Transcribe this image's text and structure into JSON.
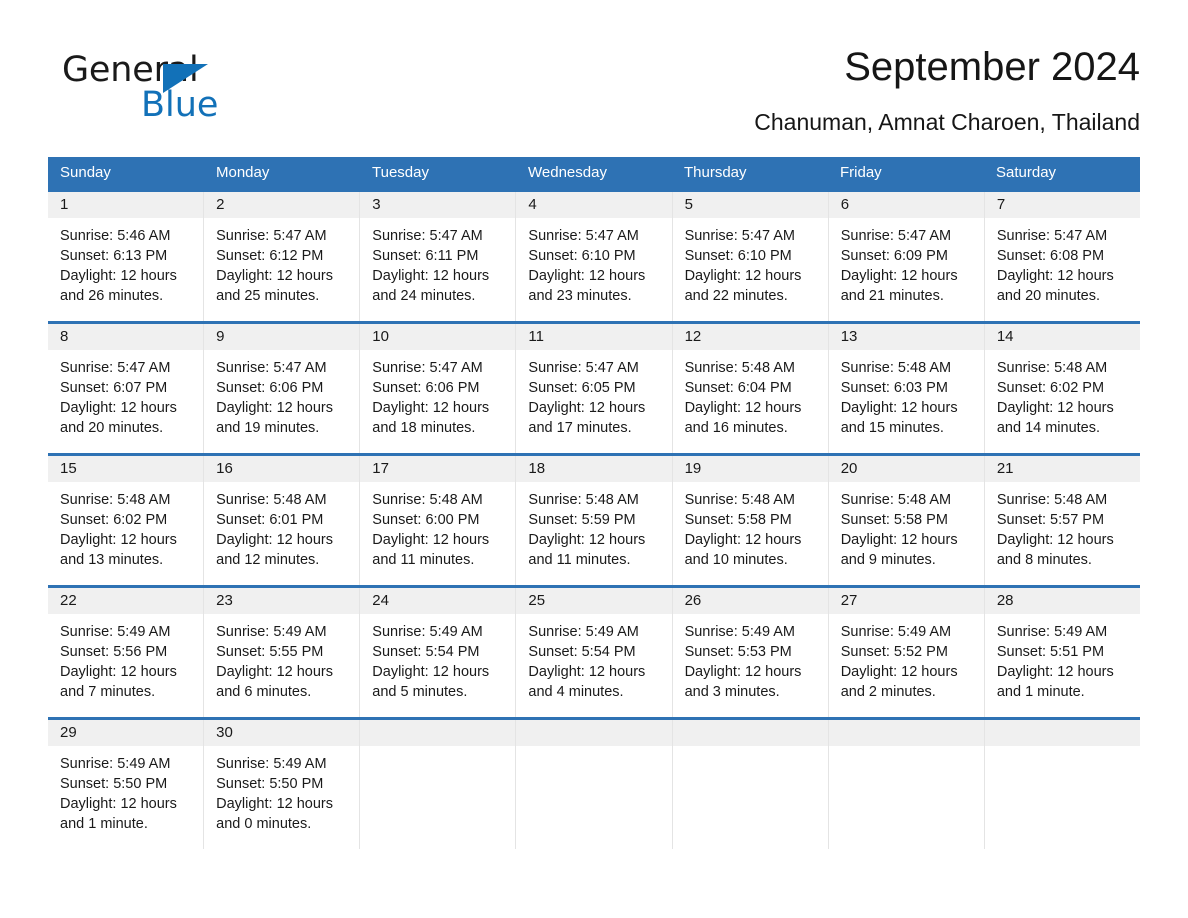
{
  "brand": {
    "name_part1": "General",
    "name_part2": "Blue",
    "logo_icon": "triangle-logo-icon",
    "accent_color": "#1271b8"
  },
  "header": {
    "title": "September 2024",
    "location": "Chanuman, Amnat Charoen, Thailand"
  },
  "theme": {
    "header_blue": "#2e72b4",
    "day_band_gray": "#f0f0f0",
    "cell_border": "#e4e4e4"
  },
  "weekdays": [
    "Sunday",
    "Monday",
    "Tuesday",
    "Wednesday",
    "Thursday",
    "Friday",
    "Saturday"
  ],
  "weeks": [
    [
      {
        "day": "1",
        "sunrise": "Sunrise: 5:46 AM",
        "sunset": "Sunset: 6:13 PM",
        "daylight1": "Daylight: 12 hours",
        "daylight2": "and 26 minutes."
      },
      {
        "day": "2",
        "sunrise": "Sunrise: 5:47 AM",
        "sunset": "Sunset: 6:12 PM",
        "daylight1": "Daylight: 12 hours",
        "daylight2": "and 25 minutes."
      },
      {
        "day": "3",
        "sunrise": "Sunrise: 5:47 AM",
        "sunset": "Sunset: 6:11 PM",
        "daylight1": "Daylight: 12 hours",
        "daylight2": "and 24 minutes."
      },
      {
        "day": "4",
        "sunrise": "Sunrise: 5:47 AM",
        "sunset": "Sunset: 6:10 PM",
        "daylight1": "Daylight: 12 hours",
        "daylight2": "and 23 minutes."
      },
      {
        "day": "5",
        "sunrise": "Sunrise: 5:47 AM",
        "sunset": "Sunset: 6:10 PM",
        "daylight1": "Daylight: 12 hours",
        "daylight2": "and 22 minutes."
      },
      {
        "day": "6",
        "sunrise": "Sunrise: 5:47 AM",
        "sunset": "Sunset: 6:09 PM",
        "daylight1": "Daylight: 12 hours",
        "daylight2": "and 21 minutes."
      },
      {
        "day": "7",
        "sunrise": "Sunrise: 5:47 AM",
        "sunset": "Sunset: 6:08 PM",
        "daylight1": "Daylight: 12 hours",
        "daylight2": "and 20 minutes."
      }
    ],
    [
      {
        "day": "8",
        "sunrise": "Sunrise: 5:47 AM",
        "sunset": "Sunset: 6:07 PM",
        "daylight1": "Daylight: 12 hours",
        "daylight2": "and 20 minutes."
      },
      {
        "day": "9",
        "sunrise": "Sunrise: 5:47 AM",
        "sunset": "Sunset: 6:06 PM",
        "daylight1": "Daylight: 12 hours",
        "daylight2": "and 19 minutes."
      },
      {
        "day": "10",
        "sunrise": "Sunrise: 5:47 AM",
        "sunset": "Sunset: 6:06 PM",
        "daylight1": "Daylight: 12 hours",
        "daylight2": "and 18 minutes."
      },
      {
        "day": "11",
        "sunrise": "Sunrise: 5:47 AM",
        "sunset": "Sunset: 6:05 PM",
        "daylight1": "Daylight: 12 hours",
        "daylight2": "and 17 minutes."
      },
      {
        "day": "12",
        "sunrise": "Sunrise: 5:48 AM",
        "sunset": "Sunset: 6:04 PM",
        "daylight1": "Daylight: 12 hours",
        "daylight2": "and 16 minutes."
      },
      {
        "day": "13",
        "sunrise": "Sunrise: 5:48 AM",
        "sunset": "Sunset: 6:03 PM",
        "daylight1": "Daylight: 12 hours",
        "daylight2": "and 15 minutes."
      },
      {
        "day": "14",
        "sunrise": "Sunrise: 5:48 AM",
        "sunset": "Sunset: 6:02 PM",
        "daylight1": "Daylight: 12 hours",
        "daylight2": "and 14 minutes."
      }
    ],
    [
      {
        "day": "15",
        "sunrise": "Sunrise: 5:48 AM",
        "sunset": "Sunset: 6:02 PM",
        "daylight1": "Daylight: 12 hours",
        "daylight2": "and 13 minutes."
      },
      {
        "day": "16",
        "sunrise": "Sunrise: 5:48 AM",
        "sunset": "Sunset: 6:01 PM",
        "daylight1": "Daylight: 12 hours",
        "daylight2": "and 12 minutes."
      },
      {
        "day": "17",
        "sunrise": "Sunrise: 5:48 AM",
        "sunset": "Sunset: 6:00 PM",
        "daylight1": "Daylight: 12 hours",
        "daylight2": "and 11 minutes."
      },
      {
        "day": "18",
        "sunrise": "Sunrise: 5:48 AM",
        "sunset": "Sunset: 5:59 PM",
        "daylight1": "Daylight: 12 hours",
        "daylight2": "and 11 minutes."
      },
      {
        "day": "19",
        "sunrise": "Sunrise: 5:48 AM",
        "sunset": "Sunset: 5:58 PM",
        "daylight1": "Daylight: 12 hours",
        "daylight2": "and 10 minutes."
      },
      {
        "day": "20",
        "sunrise": "Sunrise: 5:48 AM",
        "sunset": "Sunset: 5:58 PM",
        "daylight1": "Daylight: 12 hours",
        "daylight2": "and 9 minutes."
      },
      {
        "day": "21",
        "sunrise": "Sunrise: 5:48 AM",
        "sunset": "Sunset: 5:57 PM",
        "daylight1": "Daylight: 12 hours",
        "daylight2": "and 8 minutes."
      }
    ],
    [
      {
        "day": "22",
        "sunrise": "Sunrise: 5:49 AM",
        "sunset": "Sunset: 5:56 PM",
        "daylight1": "Daylight: 12 hours",
        "daylight2": "and 7 minutes."
      },
      {
        "day": "23",
        "sunrise": "Sunrise: 5:49 AM",
        "sunset": "Sunset: 5:55 PM",
        "daylight1": "Daylight: 12 hours",
        "daylight2": "and 6 minutes."
      },
      {
        "day": "24",
        "sunrise": "Sunrise: 5:49 AM",
        "sunset": "Sunset: 5:54 PM",
        "daylight1": "Daylight: 12 hours",
        "daylight2": "and 5 minutes."
      },
      {
        "day": "25",
        "sunrise": "Sunrise: 5:49 AM",
        "sunset": "Sunset: 5:54 PM",
        "daylight1": "Daylight: 12 hours",
        "daylight2": "and 4 minutes."
      },
      {
        "day": "26",
        "sunrise": "Sunrise: 5:49 AM",
        "sunset": "Sunset: 5:53 PM",
        "daylight1": "Daylight: 12 hours",
        "daylight2": "and 3 minutes."
      },
      {
        "day": "27",
        "sunrise": "Sunrise: 5:49 AM",
        "sunset": "Sunset: 5:52 PM",
        "daylight1": "Daylight: 12 hours",
        "daylight2": "and 2 minutes."
      },
      {
        "day": "28",
        "sunrise": "Sunrise: 5:49 AM",
        "sunset": "Sunset: 5:51 PM",
        "daylight1": "Daylight: 12 hours",
        "daylight2": "and 1 minute."
      }
    ],
    [
      {
        "day": "29",
        "sunrise": "Sunrise: 5:49 AM",
        "sunset": "Sunset: 5:50 PM",
        "daylight1": "Daylight: 12 hours",
        "daylight2": "and 1 minute."
      },
      {
        "day": "30",
        "sunrise": "Sunrise: 5:49 AM",
        "sunset": "Sunset: 5:50 PM",
        "daylight1": "Daylight: 12 hours",
        "daylight2": "and 0 minutes."
      },
      {
        "day": "",
        "sunrise": "",
        "sunset": "",
        "daylight1": "",
        "daylight2": ""
      },
      {
        "day": "",
        "sunrise": "",
        "sunset": "",
        "daylight1": "",
        "daylight2": ""
      },
      {
        "day": "",
        "sunrise": "",
        "sunset": "",
        "daylight1": "",
        "daylight2": ""
      },
      {
        "day": "",
        "sunrise": "",
        "sunset": "",
        "daylight1": "",
        "daylight2": ""
      },
      {
        "day": "",
        "sunrise": "",
        "sunset": "",
        "daylight1": "",
        "daylight2": ""
      }
    ]
  ]
}
